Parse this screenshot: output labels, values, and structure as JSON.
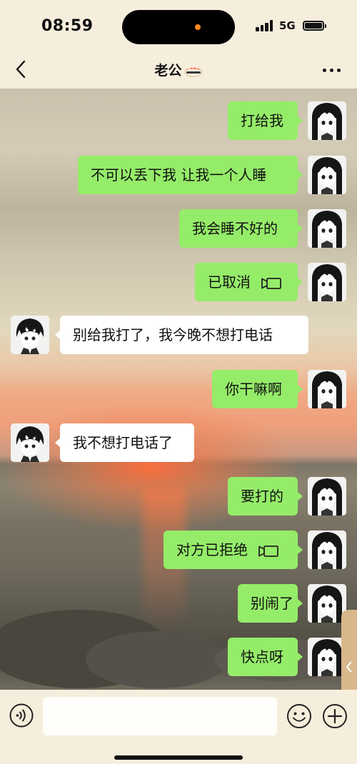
{
  "status_bar": {
    "time": "08:59",
    "network": "5G"
  },
  "header": {
    "title": "老公"
  },
  "messages": [
    {
      "sender": "me",
      "text": "打给我"
    },
    {
      "sender": "me",
      "text": "不可以丢下我 让我一个人睡"
    },
    {
      "sender": "me",
      "text": "我会睡不好的"
    },
    {
      "sender": "me",
      "text": "已取消",
      "call": true
    },
    {
      "sender": "peer",
      "text": "别给我打了，我今晚不想打电话"
    },
    {
      "sender": "me",
      "text": "你干嘛啊"
    },
    {
      "sender": "peer",
      "text": "我不想打电话了"
    },
    {
      "sender": "me",
      "text": "要打的"
    },
    {
      "sender": "me",
      "text": "对方已拒绝",
      "call": true
    },
    {
      "sender": "me",
      "text": "别闹了"
    },
    {
      "sender": "me",
      "text": "快点呀"
    }
  ],
  "input": {
    "value": ""
  },
  "colors": {
    "my_bubble": "#95ec69",
    "peer_bubble": "#ffffff"
  },
  "icons": [
    "back-icon",
    "more-icon",
    "video-call-icon",
    "voice-icon",
    "emoji-icon",
    "plus-icon",
    "chevron-left-icon"
  ]
}
